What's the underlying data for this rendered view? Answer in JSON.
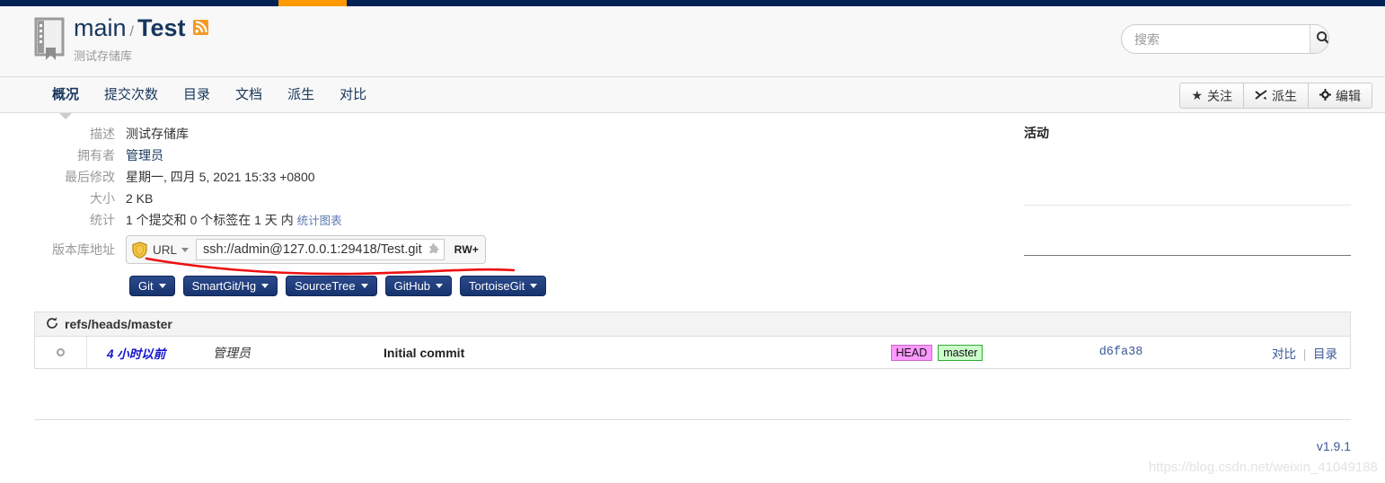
{
  "theme": {
    "topbar_color": "#002255",
    "topbar_accent_color": "#ff9900",
    "title_color": "#17365d",
    "link_color": "#3b5998",
    "client_button_color": "#16336e",
    "head_badge_color": "#ff99ff",
    "branch_badge_color": "#ccffcc"
  },
  "header": {
    "repo_icon": "repository-book-icon",
    "owner_name": "main",
    "separator": "/",
    "repo_name": "Test",
    "feed_icon": "rss-feed-icon",
    "description": "测试存储库"
  },
  "search": {
    "placeholder": "搜索",
    "value": "",
    "button_icon": "search-icon"
  },
  "nav": {
    "tabs": [
      {
        "label": "概况",
        "active": true
      },
      {
        "label": "提交次数",
        "active": false
      },
      {
        "label": "目录",
        "active": false
      },
      {
        "label": "文档",
        "active": false
      },
      {
        "label": "派生",
        "active": false
      },
      {
        "label": "对比",
        "active": false
      }
    ],
    "actions": [
      {
        "icon": "star-icon",
        "glyph": "★",
        "label": "关注"
      },
      {
        "icon": "fork-icon",
        "glyph": "⤳",
        "label": "派生"
      },
      {
        "icon": "gear-icon",
        "glyph": "✿",
        "label": "编辑"
      }
    ]
  },
  "info": {
    "rows": [
      {
        "label": "描述",
        "value": "测试存储库",
        "is_link": false
      },
      {
        "label": "拥有者",
        "value": "管理员",
        "is_link": true
      },
      {
        "label": "最后修改",
        "value": "星期一, 四月 5, 2021 15:33 +0800",
        "is_link": false
      },
      {
        "label": "大小",
        "value": "2 KB",
        "is_link": false
      }
    ],
    "stats_label": "统计",
    "stats_value": "1 个提交和 0 个标签在 1 天 内",
    "stats_link": "统计图表"
  },
  "url_section": {
    "label": "版本库地址",
    "shield_icon": "shield-icon",
    "protocol_label": "URL",
    "dropdown_icon": "chevron-down-icon",
    "url_value": "ssh://admin@127.0.0.1:29418/Test.git",
    "copy_icon": "puzzle-piece-icon",
    "permission_badge": "RW+",
    "annotation": "red-underline-annotation"
  },
  "clients": [
    {
      "label": "Git"
    },
    {
      "label": "SmartGit/Hg"
    },
    {
      "label": "SourceTree"
    },
    {
      "label": "GitHub"
    },
    {
      "label": "TortoiseGit"
    }
  ],
  "activity": {
    "title": "活动"
  },
  "commit_table": {
    "refresh_icon": "refresh-icon",
    "head_title": "refs/heads/master",
    "rows": [
      {
        "node_icon": "commit-node-icon",
        "when": "4 小时以前",
        "author": "管理员",
        "message": "Initial commit",
        "head_badge": "HEAD",
        "branch_badge": "master",
        "hash": "d6fa38",
        "link_diff": "对比",
        "link_sep": "|",
        "link_tree": "目录"
      }
    ]
  },
  "footer": {
    "version": "v1.9.1",
    "watermark": "https://blog.csdn.net/weixin_41049188"
  }
}
